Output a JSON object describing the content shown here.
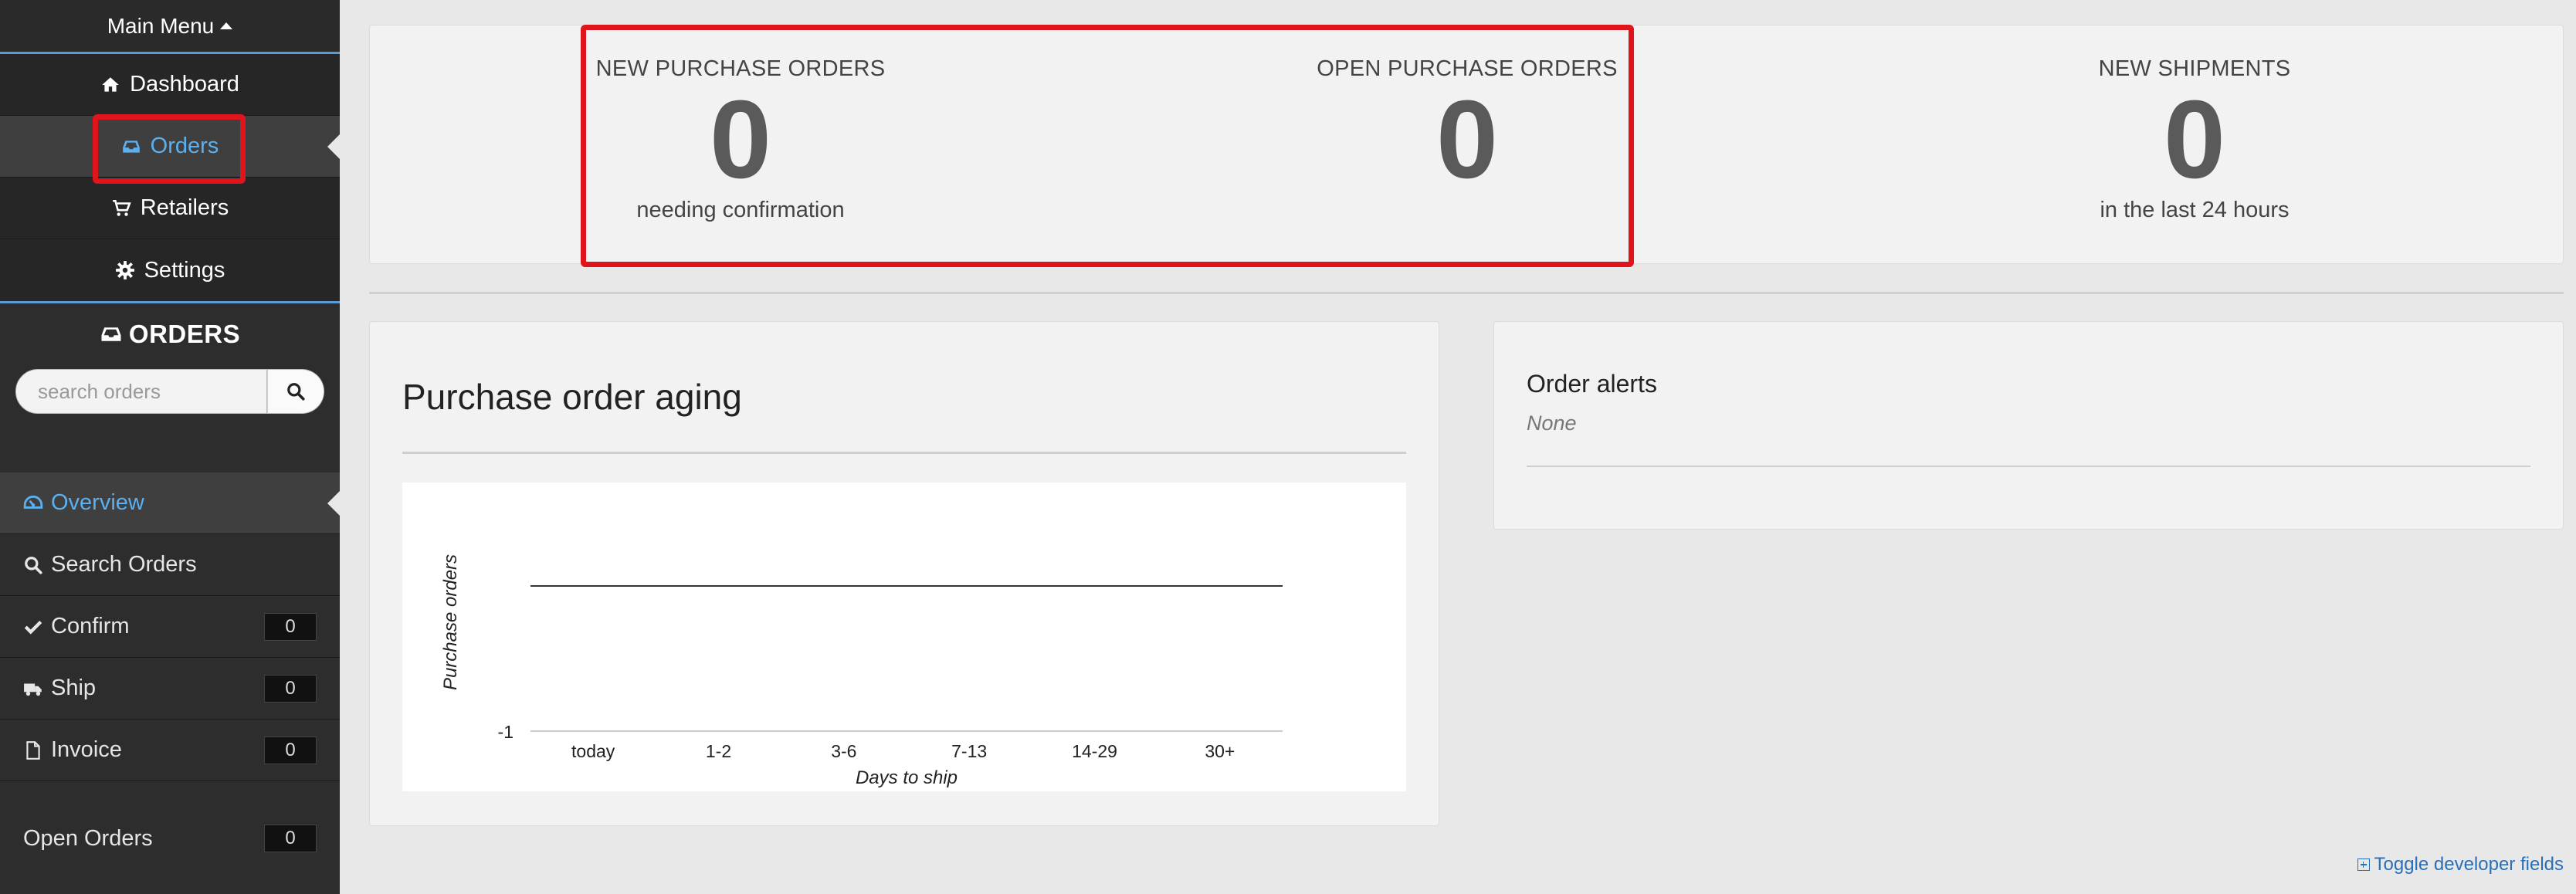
{
  "sidebar": {
    "menu_header": "Main Menu",
    "main_items": [
      {
        "label": "Dashboard",
        "icon": "home-icon",
        "active": false
      },
      {
        "label": "Orders",
        "icon": "inbox-icon",
        "active": true
      },
      {
        "label": "Retailers",
        "icon": "cart-icon",
        "active": false
      },
      {
        "label": "Settings",
        "icon": "gear-icon",
        "active": false
      }
    ],
    "section_title": "ORDERS",
    "search": {
      "placeholder": "search orders"
    },
    "sub_items": [
      {
        "label": "Overview",
        "icon": "dashboard-icon",
        "active": true
      },
      {
        "label": "Search Orders",
        "icon": "search-icon"
      },
      {
        "label": "Confirm",
        "icon": "check-icon",
        "count": "0"
      },
      {
        "label": "Ship",
        "icon": "truck-icon",
        "count": "0"
      },
      {
        "label": "Invoice",
        "icon": "file-icon",
        "count": "0"
      }
    ],
    "open_orders": {
      "label": "Open Orders",
      "count": "0"
    }
  },
  "stats": {
    "new_po": {
      "label": "NEW PURCHASE ORDERS",
      "value": "0",
      "sub": "needing confirmation"
    },
    "open_po": {
      "label": "OPEN PURCHASE ORDERS",
      "value": "0",
      "sub": ""
    },
    "new_shipments": {
      "label": "NEW SHIPMENTS",
      "value": "0",
      "sub": "in the last 24 hours"
    }
  },
  "aging": {
    "title": "Purchase order aging"
  },
  "alerts": {
    "title": "Order alerts",
    "empty_text": "None"
  },
  "dev_toggle": "Toggle developer fields",
  "chart_data": {
    "type": "line",
    "categories": [
      "today",
      "1-2",
      "3-6",
      "7-13",
      "14-29",
      "30+"
    ],
    "values": [
      0,
      0,
      0,
      0,
      0,
      0
    ],
    "xlabel": "Days to ship",
    "ylabel": "Purchase orders",
    "y_ticks": [
      "-1"
    ],
    "ylim": [
      -1,
      0.5
    ],
    "grid": false
  }
}
